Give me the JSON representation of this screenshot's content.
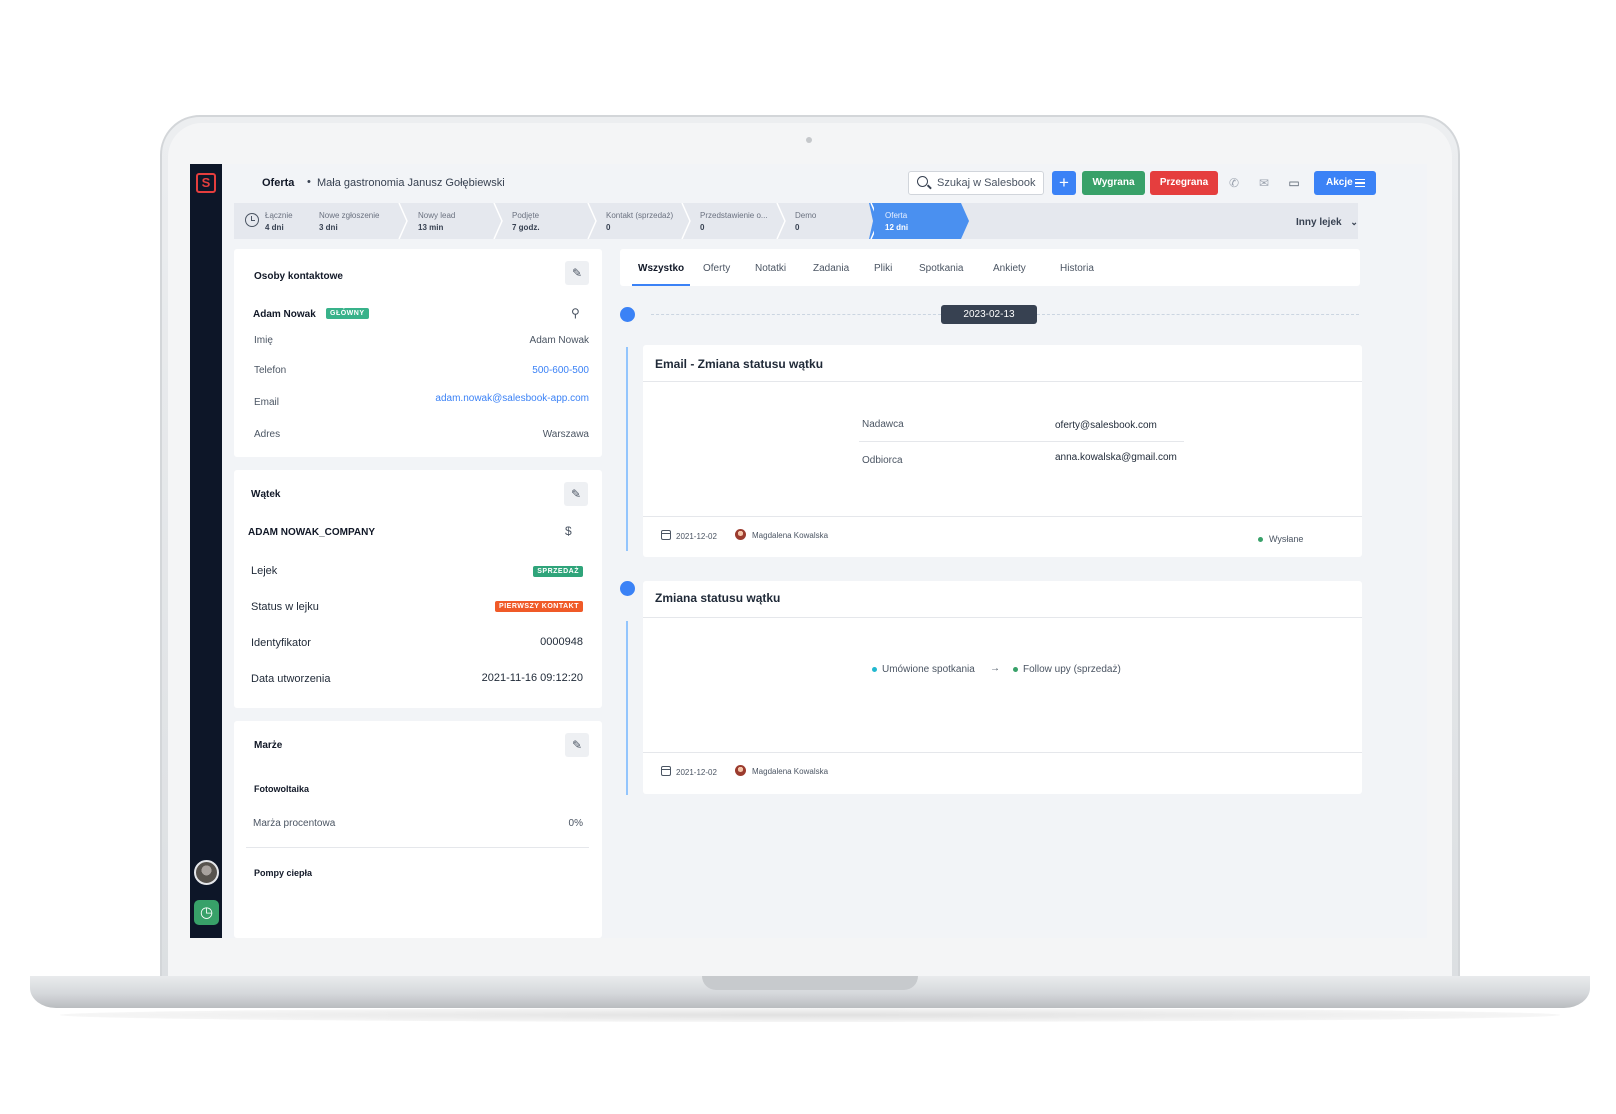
{
  "header": {
    "stage": "Oferta",
    "separator": "•",
    "title": "Mała gastronomia Janusz Gołębiewski",
    "search_placeholder": "Szukaj w Salesbook",
    "add_label": "+",
    "won_label": "Wygrana",
    "lost_label": "Przegrana",
    "actions_label": "Akcje"
  },
  "pipeline": {
    "stages": [
      {
        "label": "Łącznie",
        "value": "4 dni"
      },
      {
        "label": "Nowe zgłoszenie",
        "value": "3 dni"
      },
      {
        "label": "Nowy lead",
        "value": "13 min"
      },
      {
        "label": "Podjęte",
        "value": "7 godz."
      },
      {
        "label": "Kontakt (sprzedaż)",
        "value": "0"
      },
      {
        "label": "Przedstawienie o...",
        "value": "0"
      },
      {
        "label": "Demo",
        "value": "0"
      },
      {
        "label": "Oferta",
        "value": "12 dni"
      }
    ],
    "funnel_select": "Inny lejek"
  },
  "contacts": {
    "title": "Osoby kontaktowe",
    "name": "Adam Nowak",
    "badge": "GŁÓWNY",
    "rows": [
      {
        "label": "Imię",
        "value": "Adam Nowak"
      },
      {
        "label": "Telefon",
        "value": "500-600-500"
      },
      {
        "label": "Email",
        "value": "adam.nowak@salesbook-app.com"
      },
      {
        "label": "Adres",
        "value": "Warszawa"
      }
    ]
  },
  "thread": {
    "title": "Wątek",
    "company": "ADAM NOWAK_COMPANY",
    "rows": [
      {
        "label": "Lejek",
        "value": "SPRZEDAŻ"
      },
      {
        "label": "Status w lejku",
        "value": "PIERWSZY KONTAKT"
      },
      {
        "label": "Identyfikator",
        "value": "0000948"
      },
      {
        "label": "Data utworzenia",
        "value": "2021-11-16 09:12:20"
      }
    ]
  },
  "margins": {
    "title": "Marże",
    "group1": "Fotowoltaika",
    "row1_label": "Marża procentowa",
    "row1_value": "0%",
    "group2": "Pompy ciepła"
  },
  "tabs": [
    "Wszystko",
    "Oferty",
    "Notatki",
    "Zadania",
    "Pliki",
    "Spotkania",
    "Ankiety",
    "Historia"
  ],
  "timeline": {
    "date": "2023-02-13",
    "entries": [
      {
        "title": "Email - Zmiana statusu wątku",
        "sender_label": "Nadawca",
        "sender_value": "oferty@salesbook.com",
        "recipient_label": "Odbiorca",
        "recipient_value": "anna.kowalska@gmail.com",
        "date": "2021-12-02",
        "author": "Magdalena Kowalska",
        "status": "Wysłane"
      },
      {
        "title": "Zmiana statusu wątku",
        "from_status": "Umówione spotkania",
        "to_status": "Follow upy (sprzedaż)",
        "date": "2021-12-02",
        "author": "Magdalena Kowalska"
      }
    ]
  },
  "colors": {
    "primary": "#3b82f6",
    "success": "#38a169",
    "danger": "#e53e3e",
    "rail": "#0d1628",
    "badge_main": "#38b28a",
    "badge_funnel": "#2fa47a",
    "badge_status": "#f05a28"
  }
}
